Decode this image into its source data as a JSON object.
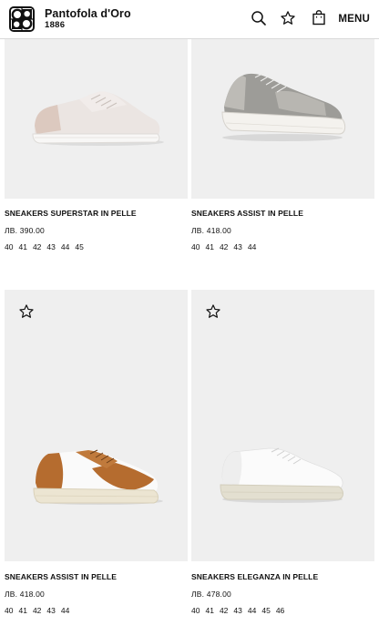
{
  "header": {
    "brand_name": "Pantofola d'Oro",
    "brand_year": "1886",
    "icons": [
      "search-icon",
      "star-icon",
      "bag-icon"
    ],
    "menu_label": "MENU"
  },
  "products": [
    {
      "name": "SNEAKERS SUPERSTAR IN PELLE",
      "price": "ЛВ. 390.00",
      "sizes": [
        "40",
        "41",
        "42",
        "43",
        "44",
        "45"
      ],
      "colors": {
        "upper": "#ebe5e2",
        "accent": "#dcc9bf",
        "sole": "#f6f4f2"
      }
    },
    {
      "name": "SNEAKERS ASSIST IN PELLE",
      "price": "ЛВ. 418.00",
      "sizes": [
        "40",
        "41",
        "42",
        "43",
        "44"
      ],
      "colors": {
        "upper": "#9d9c98",
        "accent": "#bdbbb6",
        "sole": "#f4f2ee"
      }
    },
    {
      "name": "SNEAKERS ASSIST IN PELLE",
      "price": "ЛВ. 418.00",
      "sizes": [
        "40",
        "41",
        "42",
        "43",
        "44"
      ],
      "colors": {
        "upper": "#fafafa",
        "accent": "#b56c2f",
        "sole": "#ece5d2"
      }
    },
    {
      "name": "SNEAKERS ELEGANZA IN PELLE",
      "price": "ЛВ. 478.00",
      "sizes": [
        "40",
        "41",
        "42",
        "43",
        "44",
        "45",
        "46"
      ],
      "colors": {
        "upper": "#fbfbfb",
        "accent": "#e6e6e6",
        "sole": "#e3dfd0"
      }
    }
  ]
}
